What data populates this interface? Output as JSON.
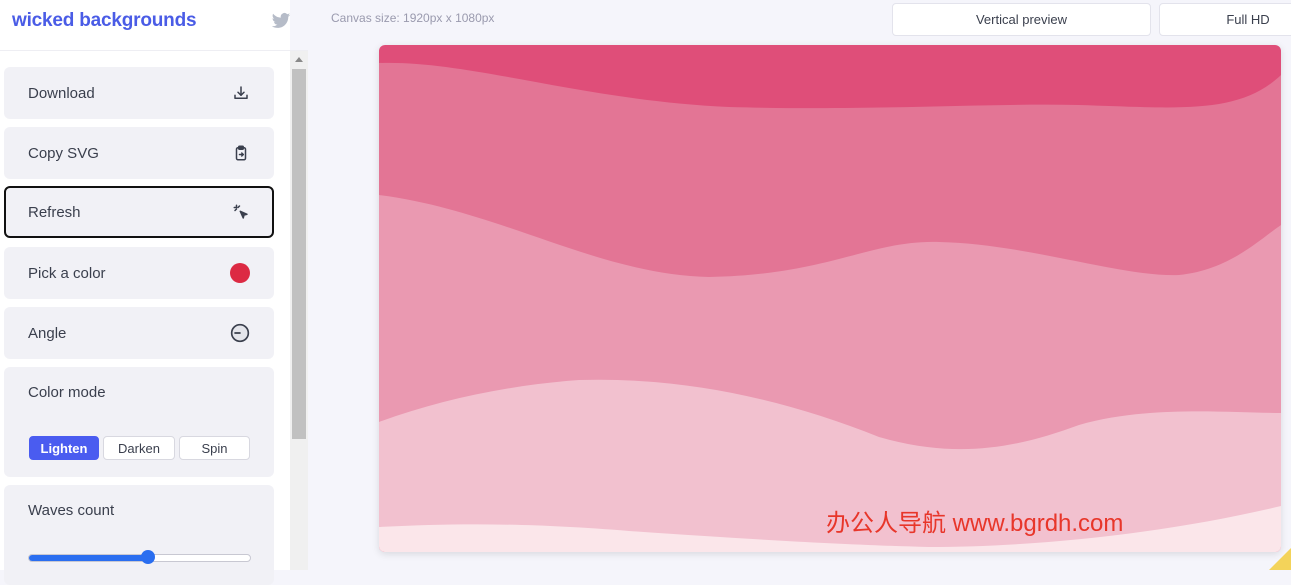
{
  "brand": {
    "title": "wicked backgrounds",
    "twitter_icon": "twitter-icon"
  },
  "sidebar": {
    "download": {
      "label": "Download",
      "icon": "download-icon"
    },
    "copy_svg": {
      "label": "Copy SVG",
      "icon": "clipboard-icon"
    },
    "refresh": {
      "label": "Refresh",
      "icon": "magic-cursor-icon"
    },
    "pick_color": {
      "label": "Pick a color",
      "color": "#dc2a43"
    },
    "angle": {
      "label": "Angle",
      "icon": "clock-icon"
    },
    "color_mode": {
      "label": "Color mode",
      "options": [
        "Lighten",
        "Darken",
        "Spin"
      ],
      "selected": "Lighten"
    },
    "waves_count": {
      "label": "Waves count",
      "value_fraction": 0.54
    }
  },
  "topbar": {
    "canvas_size": "Canvas size: 1920px x 1080px",
    "vertical_preview": "Vertical preview",
    "full_hd": "Full HD"
  },
  "canvas": {
    "colors": [
      "#df4e79",
      "#e37595",
      "#ea99b1",
      "#f2c1cf",
      "#fbe6ea"
    ]
  },
  "watermark": "办公人导航 www.bgrdh.com",
  "colors": {
    "accent": "#4a5cf0",
    "brand": "#4a5ce6",
    "slider": "#2a6ef0"
  }
}
